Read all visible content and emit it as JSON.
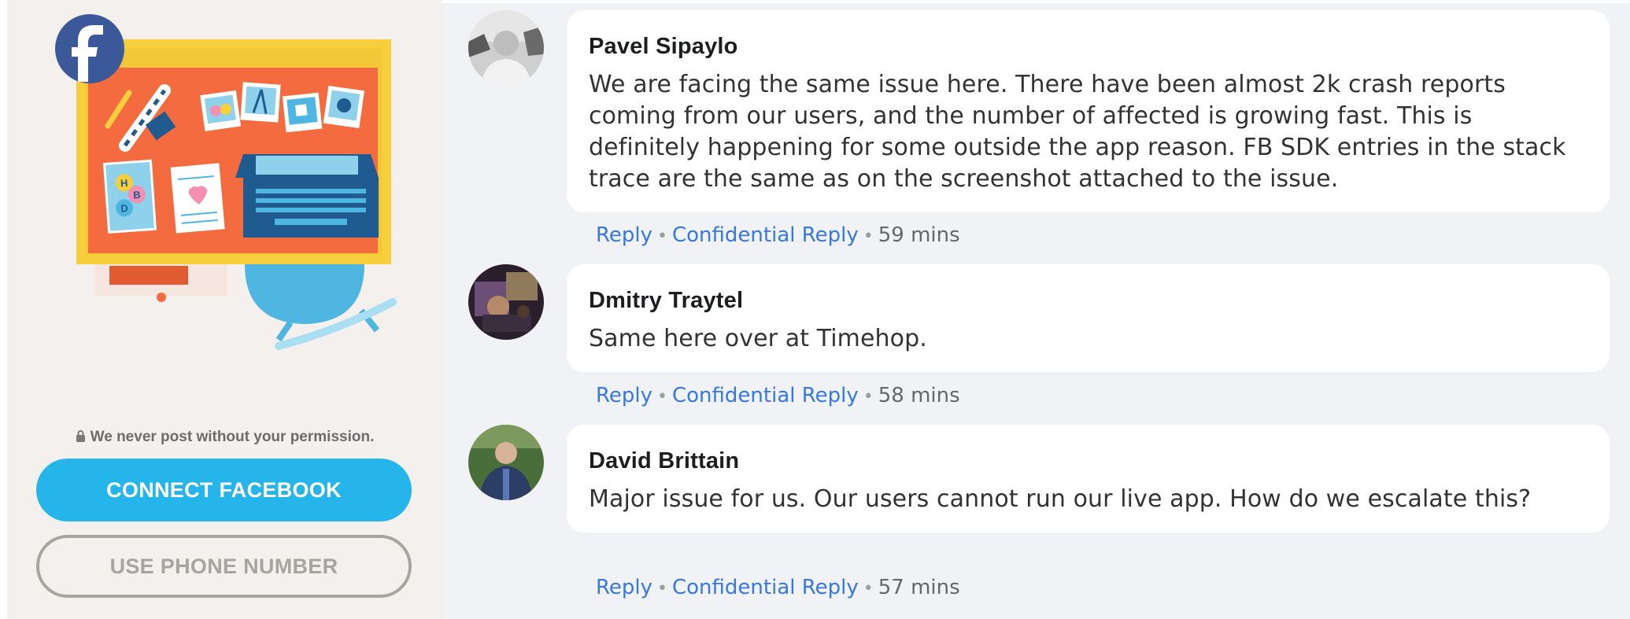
{
  "left": {
    "permission_text": "We never post without your permission.",
    "connect_button": "CONNECT FACEBOOK",
    "phone_button": "USE PHONE NUMBER",
    "illustration_letters": [
      "H",
      "B",
      "D"
    ],
    "colors": {
      "facebook_blue": "#3b5998",
      "connect_blue": "#26b5ea",
      "desk_orange": "#f36b3f"
    }
  },
  "comments": [
    {
      "author": "Pavel Sipaylo",
      "text": "We are facing the same issue here. There have been almost 2k crash reports coming from our users, and the number of affected is growing fast. This is definitely happening for some outside the app reason. FB SDK entries in the stack trace are the same as on the screenshot attached to the issue.",
      "reply": "Reply",
      "confidential_reply": "Confidential Reply",
      "time": "59 mins"
    },
    {
      "author": "Dmitry Traytel",
      "text": "Same here over at Timehop.",
      "reply": "Reply",
      "confidential_reply": "Confidential Reply",
      "time": "58 mins"
    },
    {
      "author": "David Brittain",
      "text": "Major issue for us. Our users cannot run our live app. How do we escalate this?",
      "reply": "Reply",
      "confidential_reply": "Confidential Reply",
      "time": "57 mins"
    }
  ],
  "icons": [
    "facebook-icon",
    "lock-icon"
  ]
}
